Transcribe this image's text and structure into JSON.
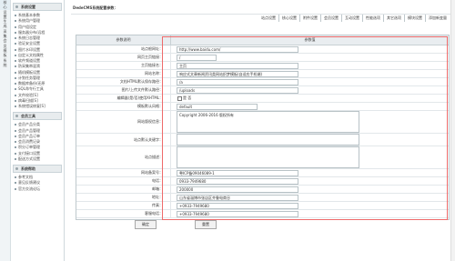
{
  "vertical_tabs": [
    "核",
    "心",
    "设",
    "置",
    "生",
    "成",
    "采",
    "集",
    "会",
    "员",
    "模",
    "板",
    "系",
    "统"
  ],
  "sidebar": {
    "sections": [
      {
        "title": "系统设置",
        "items": [
          "系统基本参数",
          "系统用户管理",
          "用户组设定",
          "服务器分布/远程",
          "系统日志管理",
          "验证安全设置",
          "图片水印设置",
          "自定义文档属性",
          "软件频道设置",
          "防采集串混淆",
          "随机模板设置",
          "计划任务管理",
          "数据库备份/还原",
          "SQL命令行工具",
          "文件校验[S]",
          "病毒扫描[S]",
          "系统错误修复[S]"
        ]
      },
      {
        "title": "会员工具",
        "items": [
          "会员产品分类",
          "会员产品管理",
          "会员产品订单",
          "会员消费记录",
          "积分订单管理",
          "支付接口设置",
          "配送方式设置"
        ]
      },
      {
        "title": "系统帮助",
        "items": [
          "参考文档",
          "意见反馈建议",
          "官方交流论坛"
        ]
      }
    ]
  },
  "brand": "DedeCMS系统配置参数：",
  "topnav": [
    "站点设置",
    "核心设置",
    "附件设置",
    "会员设置",
    "互动设置",
    "性能选项",
    "其它选项",
    "模块设置",
    "添加新变量"
  ],
  "table": {
    "head": [
      "参数说明",
      "参数值"
    ],
    "rows": [
      {
        "label": "站点根网址：",
        "value": "http://www.baidu.com/",
        "kind": "field"
      },
      {
        "label": "网页主页链接：",
        "value": "/",
        "kind": "field-short"
      },
      {
        "label": "主页链接名：",
        "value": "主页",
        "kind": "field"
      },
      {
        "label": "网站名称：",
        "value": "响应式文章新闻资讯类网站织梦模板(自适应手机端)",
        "kind": "field"
      },
      {
        "label": "文档HTML默认保存路径：",
        "value": "/a",
        "kind": "field"
      },
      {
        "label": "图片/上传文件默认路径：",
        "value": "/uploads",
        "kind": "field"
      },
      {
        "label": "编辑器(是/否)使用XHTML：",
        "value": "是  否",
        "kind": "check"
      },
      {
        "label": "模板默认风格：",
        "value": "default",
        "kind": "field-mid"
      },
      {
        "label": "网站版权信息：",
        "value": "Copyright  2006-2016  版权所有",
        "kind": "area"
      },
      {
        "label": "站点默认关键字：",
        "value": "",
        "kind": "area-small"
      },
      {
        "label": "站点描述：",
        "value": "",
        "kind": "area"
      },
      {
        "label": "网站备案号：",
        "value": "粤ICP备09046089-1",
        "kind": "field"
      },
      {
        "label": "电话：",
        "value": "0933-7949680",
        "kind": "field"
      },
      {
        "label": "邮箱：",
        "value": "200000",
        "kind": "field"
      },
      {
        "label": "地址：",
        "value": "山东省淄博市张店区齐鲁电商谷",
        "kind": "field"
      },
      {
        "label": "传真：",
        "value": "+0933-7949680",
        "kind": "field"
      },
      {
        "label": "客服电话：",
        "value": "+0933-7949680",
        "kind": "field"
      }
    ]
  },
  "buttons": {
    "confirm": "确定",
    "reset": "重置"
  }
}
